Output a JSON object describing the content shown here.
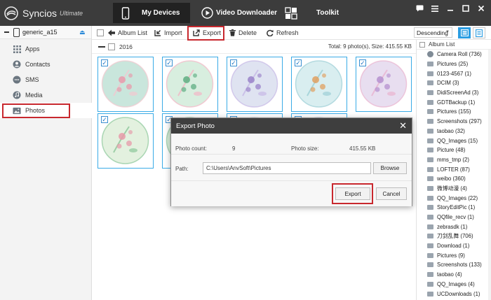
{
  "app": {
    "name": "Syncios",
    "edition": "Ultimate"
  },
  "nav": {
    "tabs": [
      {
        "label": "My Devices",
        "icon": "phone-icon"
      },
      {
        "label": "Video Downloader",
        "icon": "play-icon"
      },
      {
        "label": "Toolkit",
        "icon": "toolkit-icon"
      }
    ],
    "active": 0
  },
  "device": {
    "name": "generic_a15"
  },
  "sidebar": {
    "items": [
      {
        "label": "Apps",
        "icon": "apps-grid-icon"
      },
      {
        "label": "Contacts",
        "icon": "contacts-icon"
      },
      {
        "label": "SMS",
        "icon": "sms-icon"
      },
      {
        "label": "Media",
        "icon": "media-icon"
      },
      {
        "label": "Photos",
        "icon": "photos-icon"
      }
    ],
    "active": "Photos"
  },
  "toolbar": {
    "album_list": "Album List",
    "import": "Import",
    "export": "Export",
    "delete": "Delete",
    "refresh": "Refresh",
    "sort": "Descending"
  },
  "group": {
    "year": "2016",
    "total": "Total: 9 photo(s), Size: 415.55 KB"
  },
  "albums": {
    "header": "Album List",
    "items": [
      "Camera Roll (736)",
      "Pictures (25)",
      "0123-4567 (1)",
      "DCIM (3)",
      "DidiScreenAd (3)",
      "GDTBackup (1)",
      "Pictures (155)",
      "Screenshots (297)",
      "taobao (32)",
      "QQ_Images (15)",
      "Picture (48)",
      "mms_tmp (2)",
      "LOFTER (87)",
      "weibo (360)",
      "微博动漫 (4)",
      "QQ_Images (22)",
      "StoryEditPic (1)",
      "QQfile_recv (1)",
      "zebrasdk (1)",
      "刀剑乱舞 (706)",
      "Download (1)",
      "Pictures (9)",
      "Screenshots (133)",
      "taobao (4)",
      "QQ_Images (4)",
      "UCDownloads (1)"
    ]
  },
  "dialog": {
    "title": "Export Photo",
    "count_label": "Photo count:",
    "count_value": "9",
    "size_label": "Photo size:",
    "size_value": "415.55 KB",
    "path_label": "Path:",
    "path_value": "C:\\Users\\AnvSoft\\Pictures",
    "browse": "Browse",
    "export": "Export",
    "cancel": "Cancel"
  },
  "colors": {
    "accent": "#2b9de2",
    "highlight": "#c8282e",
    "titlebar": "#3c3c3c"
  }
}
